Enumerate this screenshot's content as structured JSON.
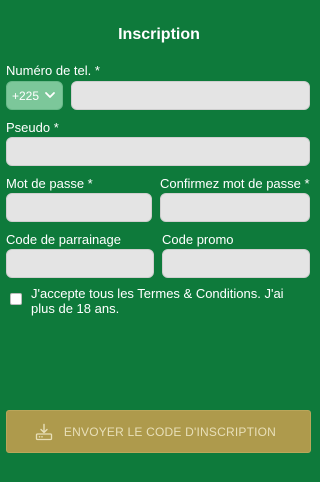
{
  "form": {
    "title": "Inscription",
    "phone_label": "Numéro de tel. *",
    "country_code": "+225",
    "phone_value": "",
    "pseudo_label": "Pseudo *",
    "pseudo_value": "",
    "password_label": "Mot de passe *",
    "password_value": "",
    "confirm_label": "Confirmez mot de passe *",
    "confirm_value": "",
    "referral_label": "Code de parrainage",
    "referral_value": "",
    "promo_label": "Code promo",
    "promo_value": "",
    "terms_text": "J'accepte tous les Termes & Conditions. J'ai plus de 18 ans.",
    "terms_checked": false,
    "submit_label": "ENVOYER LE CODE D'INSCRIPTION"
  },
  "icons": {
    "country_select": "chevron-down-icon",
    "submit": "download-icon"
  },
  "colors": {
    "background": "#0e7a3b",
    "select_bg": "#7cc79a",
    "button_bg": "#ae9a4c",
    "input_bg": "#e4e4e4"
  }
}
